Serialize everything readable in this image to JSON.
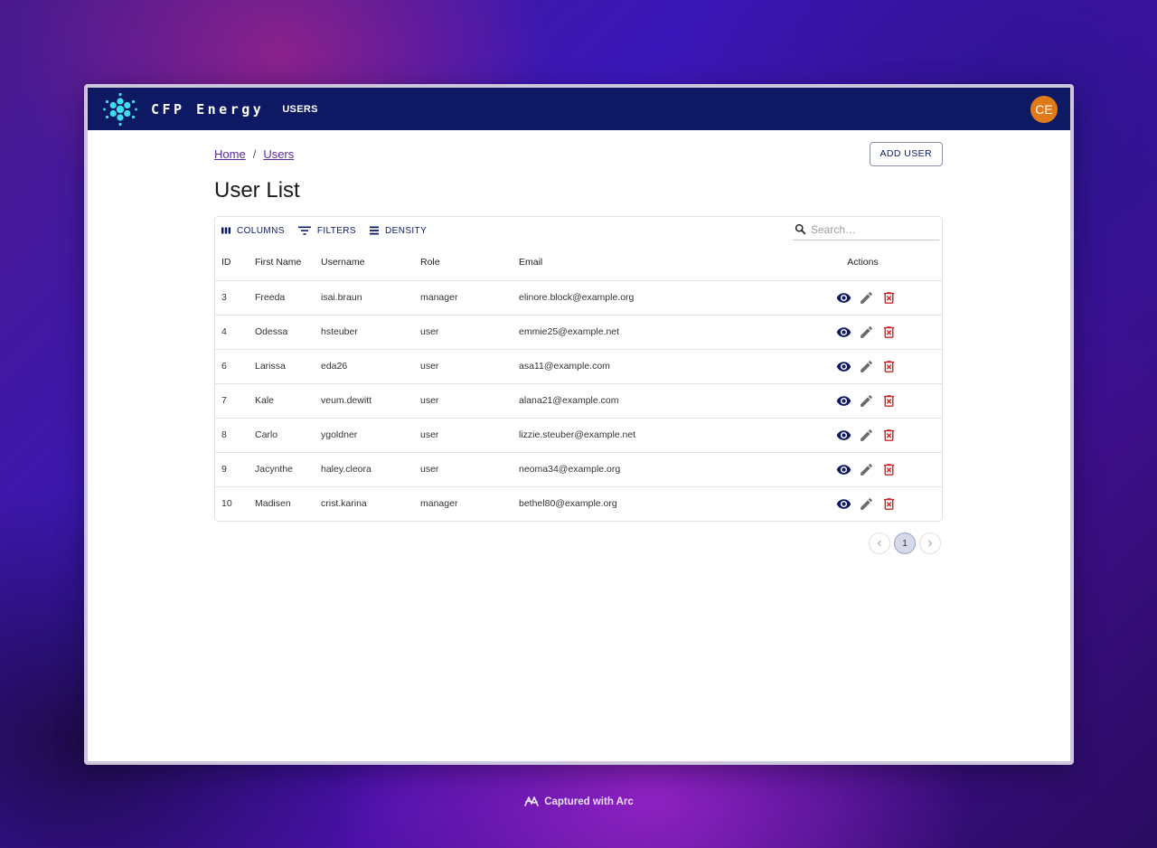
{
  "app": {
    "brand": "CFP Energy",
    "nav_users": "USERS",
    "avatar_initials": "CE"
  },
  "breadcrumb": {
    "home": "Home",
    "separator": "/",
    "users": "Users"
  },
  "add_user_label": "ADD USER",
  "page_title": "User List",
  "toolbar": {
    "columns": "COLUMNS",
    "filters": "FILTERS",
    "density": "DENSITY",
    "search_placeholder": "Search…"
  },
  "table": {
    "headers": {
      "id": "ID",
      "first_name": "First Name",
      "username": "Username",
      "role": "Role",
      "email": "Email",
      "actions": "Actions"
    },
    "rows": [
      {
        "id": "3",
        "first_name": "Freeda",
        "username": "isai.braun",
        "role": "manager",
        "email": "elinore.block@example.org"
      },
      {
        "id": "4",
        "first_name": "Odessa",
        "username": "hsteuber",
        "role": "user",
        "email": "emmie25@example.net"
      },
      {
        "id": "6",
        "first_name": "Larissa",
        "username": "eda26",
        "role": "user",
        "email": "asa11@example.com"
      },
      {
        "id": "7",
        "first_name": "Kale",
        "username": "veum.dewitt",
        "role": "user",
        "email": "alana21@example.com"
      },
      {
        "id": "8",
        "first_name": "Carlo",
        "username": "ygoldner",
        "role": "user",
        "email": "lizzie.steuber@example.net"
      },
      {
        "id": "9",
        "first_name": "Jacynthe",
        "username": "haley.cleora",
        "role": "user",
        "email": "neoma34@example.org"
      },
      {
        "id": "10",
        "first_name": "Madisen",
        "username": "crist.karina",
        "role": "manager",
        "email": "bethel80@example.org"
      }
    ]
  },
  "pagination": {
    "current_page": "1"
  },
  "footer": {
    "captured": "Captured with Arc"
  },
  "colors": {
    "appbar": "#0d1a63",
    "avatar": "#e07a19",
    "view_icon": "#0d1a63",
    "edit_icon": "#6b6b6b",
    "delete_icon": "#c62828",
    "logo": "#3ee0f0"
  },
  "icons": {
    "logo": "atom-dots-logo",
    "columns": "columns-icon",
    "filters": "filter-icon",
    "density": "density-icon",
    "search": "search-icon",
    "view": "eye-icon",
    "edit": "pencil-icon",
    "delete": "trash-icon",
    "prev": "chevron-left-icon",
    "next": "chevron-right-icon",
    "arc": "arc-logo-icon"
  }
}
